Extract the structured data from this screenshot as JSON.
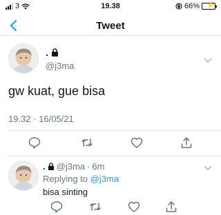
{
  "status_bar": {
    "carrier": "3",
    "time": "19.38",
    "battery": "66%",
    "battery_level": 0.66
  },
  "nav": {
    "title": "Tweet"
  },
  "tweet": {
    "display_name": ".",
    "handle": "@j3ma",
    "text": "gw kuat, gue bisa",
    "time": "19.32",
    "date": "16/05/21"
  },
  "reply": {
    "display_name": ".",
    "handle": "@j3ma",
    "age": "6m",
    "replying_label": "Replying to",
    "replying_to": "@j3ma",
    "text": "bisa sinting"
  },
  "icons": {
    "back": "chevron-left-icon",
    "lock": "lock-icon",
    "more": "chevron-down-icon",
    "reply": "comment-icon",
    "retweet": "retweet-icon",
    "like": "heart-icon",
    "share": "share-icon"
  },
  "colors": {
    "accent": "#1da1f2",
    "secondary_text": "#657786",
    "battery_fill": "#4cd964"
  }
}
